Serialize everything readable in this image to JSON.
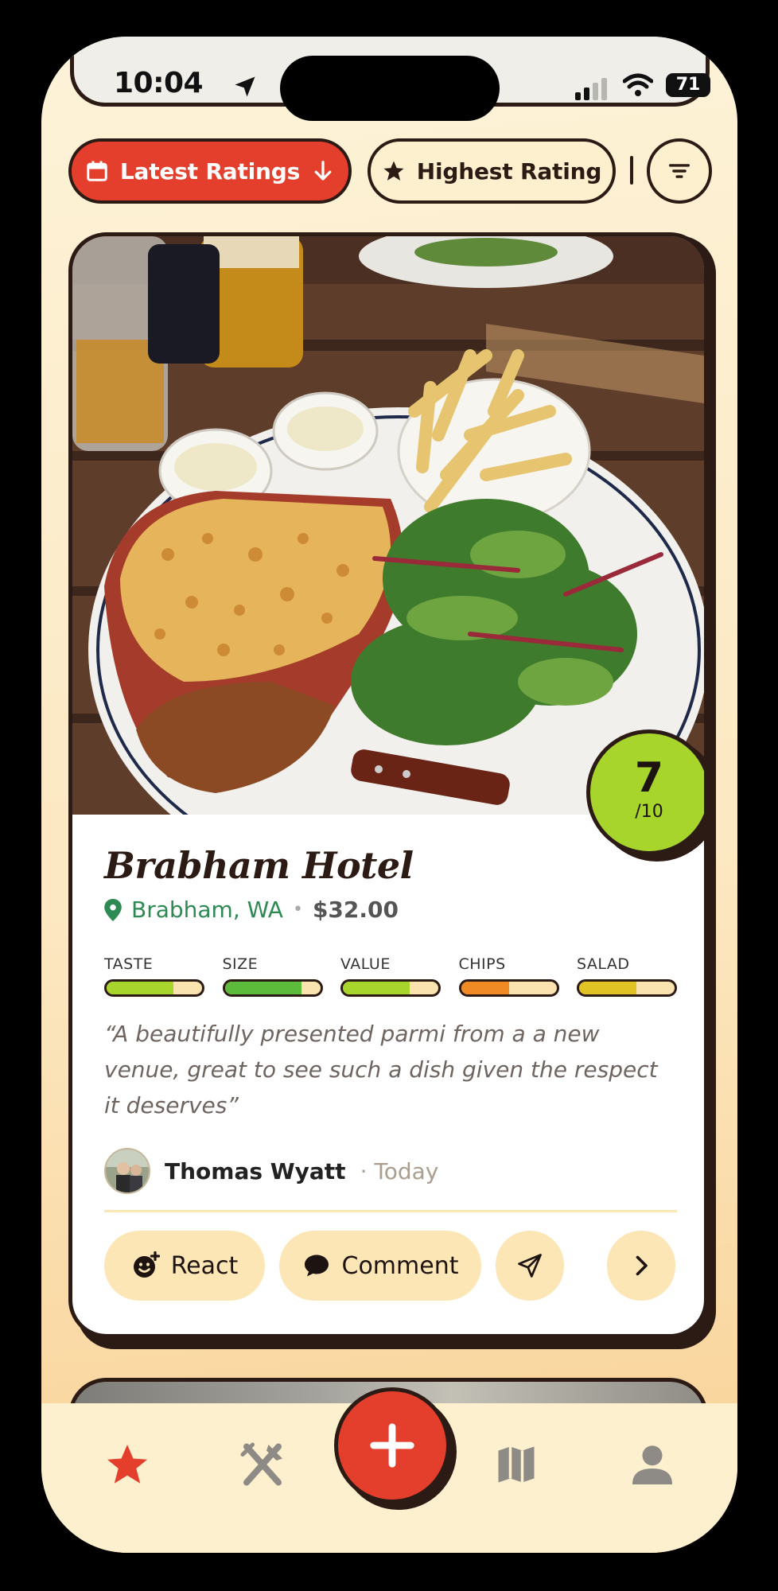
{
  "status_bar": {
    "time": "10:04",
    "battery": "71"
  },
  "filters": {
    "latest_label": "Latest Ratings",
    "highest_label": "Highest Rating"
  },
  "post": {
    "score": "7",
    "score_max": "/10",
    "place_name": "Brabham Hotel",
    "location": "Brabham, WA",
    "separator": "•",
    "price": "$32.00",
    "ratings": [
      {
        "label": "TASTE",
        "fill": 0.7,
        "color": "#a7d52b"
      },
      {
        "label": "SIZE",
        "fill": 0.8,
        "color": "#5dbb3c"
      },
      {
        "label": "VALUE",
        "fill": 0.7,
        "color": "#a7d52b"
      },
      {
        "label": "CHIPS",
        "fill": 0.5,
        "color": "#ef8a24"
      },
      {
        "label": "SALAD",
        "fill": 0.6,
        "color": "#e1c225"
      }
    ],
    "quote": "“A beautifully presented parmi from a a new venue, great to see such a dish given the respect it deserves”",
    "author_name": "Thomas Wyatt",
    "author_time": "· Today"
  },
  "actions": {
    "react_label": "React",
    "comment_label": "Comment"
  },
  "colors": {
    "accent": "#e43f2c",
    "score": "#a7d52b",
    "outline": "#2b1b14",
    "cream": "#fdf0cf"
  },
  "tab_bar": {
    "icons": [
      "star-icon",
      "fork-knife-icon",
      "plus-icon",
      "map-icon",
      "person-icon"
    ],
    "active": "star-icon"
  }
}
